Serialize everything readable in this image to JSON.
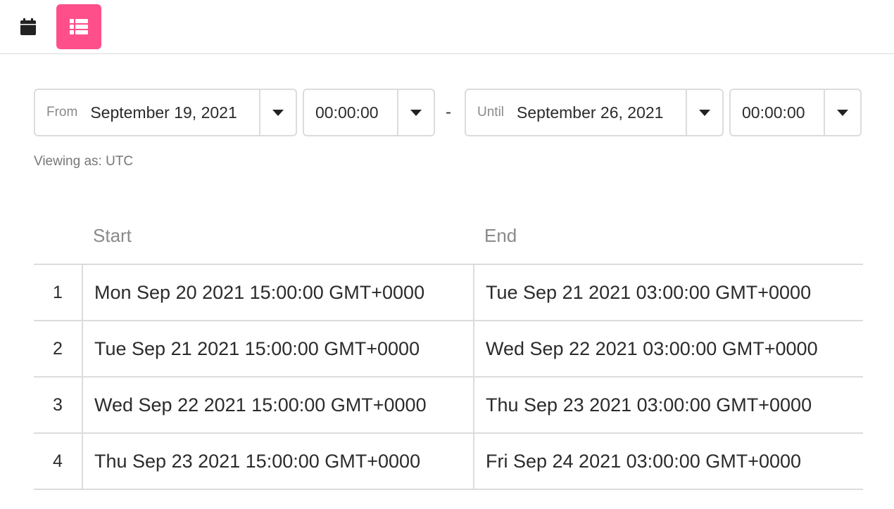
{
  "toolbar": {
    "calendar_view": {
      "icon": "calendar-icon"
    },
    "list_view": {
      "icon": "list-icon",
      "active": true,
      "color": "#ff4f8b"
    }
  },
  "range": {
    "from_label": "From",
    "from_date": "September 19, 2021",
    "from_time": "00:00:00",
    "separator": "-",
    "until_label": "Until",
    "until_date": "September 26, 2021",
    "until_time": "00:00:00"
  },
  "viewing_as": "Viewing as: UTC",
  "table": {
    "columns": {
      "index": "",
      "start": "Start",
      "end": "End"
    },
    "rows": [
      {
        "index": "1",
        "start": "Mon Sep 20 2021 15:00:00 GMT+0000",
        "end": "Tue Sep 21 2021 03:00:00 GMT+0000"
      },
      {
        "index": "2",
        "start": "Tue Sep 21 2021 15:00:00 GMT+0000",
        "end": "Wed Sep 22 2021 03:00:00 GMT+0000"
      },
      {
        "index": "3",
        "start": "Wed Sep 22 2021 15:00:00 GMT+0000",
        "end": "Thu Sep 23 2021 03:00:00 GMT+0000"
      },
      {
        "index": "4",
        "start": "Thu Sep 23 2021 15:00:00 GMT+0000",
        "end": "Fri Sep 24 2021 03:00:00 GMT+0000"
      }
    ]
  }
}
